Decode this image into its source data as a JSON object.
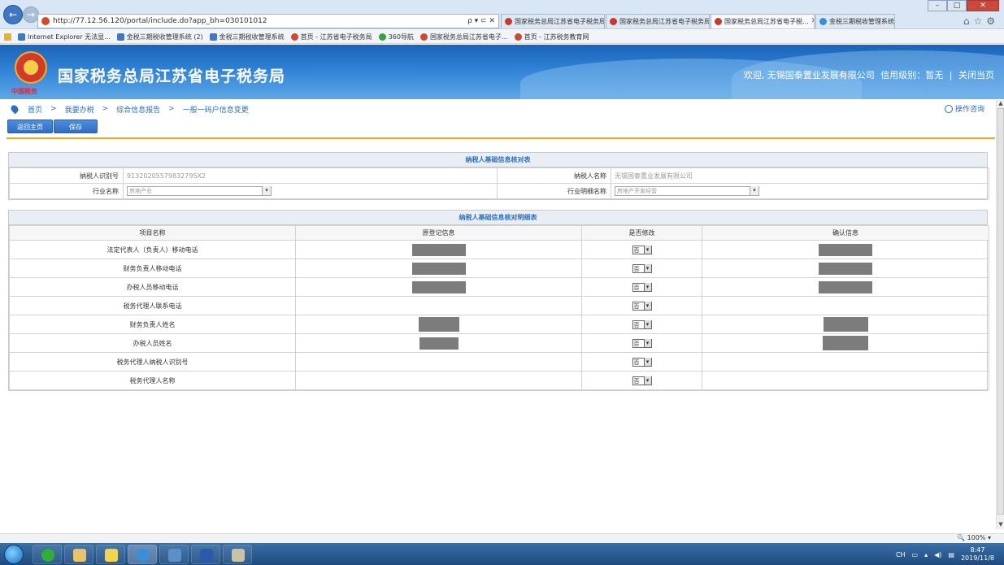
{
  "browser": {
    "url": "http://77.12.56.120/portal/include.do?app_bh=030101012",
    "addr_controls": "ρ ▾ ⊂ ✕",
    "tabs": [
      {
        "label": "国家税务总局江苏省电子税务局",
        "active": false,
        "icon": "gov-emblem-icon"
      },
      {
        "label": "国家税务总局江苏省电子税务局",
        "active": false,
        "icon": "gov-emblem-icon"
      },
      {
        "label": "国家税务总局江苏省电子税...",
        "active": true,
        "icon": "gov-emblem-icon",
        "close": "✕"
      },
      {
        "label": "金税三期税收管理系统",
        "active": false,
        "icon": "ie-icon"
      }
    ],
    "window_controls": {
      "minimize": "–",
      "maximize": "□",
      "close": "✕"
    },
    "right_icons": "⌂☆⚙",
    "favorites": [
      {
        "label": "Internet Explorer 无法显...",
        "icon": "ie-page-icon"
      },
      {
        "label": "金税三期税收管理系统 (2)",
        "icon": "ie-page-icon"
      },
      {
        "label": "金税三期税收管理系统",
        "icon": "ie-page-icon"
      },
      {
        "label": "首页 - 江苏省电子税务局",
        "icon": "gov-emblem-icon"
      },
      {
        "label": "360导航",
        "icon": "360-icon"
      },
      {
        "label": "国家税务总局江苏省电子...",
        "icon": "gov-emblem-icon"
      },
      {
        "label": "首页 - 江苏税务教育网",
        "icon": "gov-emblem-icon"
      }
    ]
  },
  "header": {
    "title": "国家税务总局江苏省电子税务局",
    "emblem_text": "中国税务",
    "welcome": "欢迎, 无锡国泰置业发展有限公司",
    "credit": "信用级别：暂无",
    "divider": "|",
    "close_page": "关闭当页"
  },
  "breadcrumb": {
    "items": [
      "首页",
      "我要办税",
      "综合信息报告",
      "一般一码户信息变更"
    ],
    "separator": ">",
    "help": "操作咨询"
  },
  "actions": {
    "back": "返回主页",
    "save": "保存"
  },
  "basic_info": {
    "title": "纳税人基础信息核对表",
    "taxpayer_id_label": "纳税人识别号",
    "taxpayer_id": "91320205579832795X2",
    "taxpayer_name_label": "纳税人名称",
    "taxpayer_name": "无锡国泰置业发展有限公司",
    "industry_label": "行业名称",
    "industry": "房地产业",
    "industry_detail_label": "行业明细名称",
    "industry_detail": "房地产开发经营"
  },
  "detail": {
    "title": "纳税人基础信息核对明细表",
    "columns": [
      "项目名称",
      "原登记信息",
      "是否修改",
      "确认信息"
    ],
    "rows": [
      {
        "item": "法定代表人（负责人）移动电话",
        "modify": "否"
      },
      {
        "item": "财务负责人移动电话",
        "modify": "否"
      },
      {
        "item": "办税人员移动电话",
        "modify": "否"
      },
      {
        "item": "税务代理人联系电话",
        "modify": "否"
      },
      {
        "item": "财务负责人姓名",
        "modify": "否"
      },
      {
        "item": "办税人员姓名",
        "modify": "否"
      },
      {
        "item": "税务代理人纳税人识别号",
        "modify": "否"
      },
      {
        "item": "税务代理人名称",
        "modify": "否"
      }
    ]
  },
  "status": {
    "zoom": "100%"
  },
  "taskbar": {
    "tray_lang": "CH",
    "time": "8:47",
    "date": "2019/11/8"
  }
}
